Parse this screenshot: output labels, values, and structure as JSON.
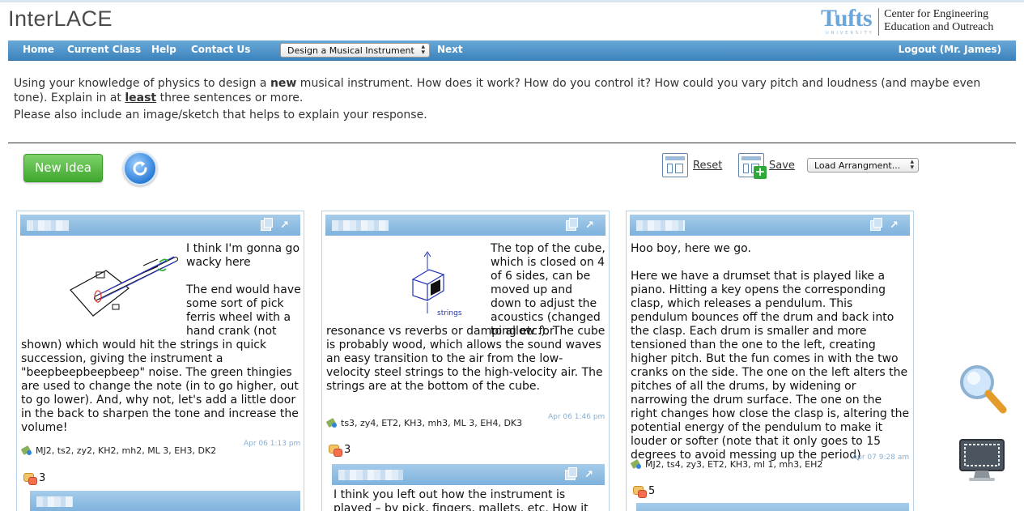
{
  "app": {
    "title": "InterLACE"
  },
  "logo": {
    "wordmark": "Tufts",
    "sub": "UNIVERSITY",
    "center_line1": "Center for Engineering",
    "center_line2": "Education and Outreach"
  },
  "nav": {
    "home": "Home",
    "current_class": "Current Class",
    "help": "Help",
    "contact": "Contact Us",
    "activity_select": "Design a Musical Instrument",
    "next": "Next",
    "logout": "Logout (Mr. James)"
  },
  "prompt": {
    "part1": "Using your knowledge of physics to design a ",
    "bold": "new",
    "part2": " musical instrument. How does it work? How do you control it?  How could you vary pitch and loudness (and maybe even tone). Explain in at ",
    "underline": "least",
    "part3": " three sentences or more.",
    "line2": "Please also include an image/sketch that helps to explain your response."
  },
  "toolbar": {
    "new_idea": "New Idea",
    "reset": "Reset",
    "save": "Save",
    "load_select": "Load Arrangment..."
  },
  "cards": [
    {
      "p1": "I think I'm gonna go wacky here",
      "p2": "The end would have some sort of pick ferris wheel with a hand crank (not shown) which would hit the strings in quick succession, giving the instrument a \"beepbeepbeepbeep\" noise. The green thingies are used to change the note (in to go higher, out to go lower). And, why not, let's add a little door in the back to sharpen the tone and increase the volume!",
      "timestamp": "Apr 06 1:13 pm",
      "tags": "MJ2, ts2, zy2, KH2, mh2, ML 3, EH3, DK2",
      "comments": "3"
    },
    {
      "p1": "The top of the cube, which is closed on 4 of 6 sides, can be moved up and down to adjust the acoustics (changed to allow for resonance vs reverbs or damping etc.). The cube is probably wood, which allows the sound waves an easy transition to the air from the low-velocity steel strings to the high-velocity air. The strings are at the bottom of the cube.",
      "sketch_label": "strings",
      "timestamp": "Apr 06 1:46 pm",
      "tags": "ts3, zy4, ET2, KH3, mh3, ML 3, EH4, DK3",
      "comments": "3",
      "reply": "I think you left out how the instrument is played – by pick, fingers, mallets, etc. How it would by"
    },
    {
      "p1": "Hoo boy, here we go.",
      "p2": "Here we have a drumset that is played like a piano. Hitting a key opens the corresponding clasp, which releases a pendulum. This pendulum bounces off the drum and back into the clasp. Each drum is smaller and more tensioned than the one to the left, creating higher pitch. But the fun comes in with the two cranks on the side. The one on the left alters the pitches of all the drums, by widening or narrowing the drum surface. The one on the right changes how close the clasp is, altering the potential energy of the pendulum to make it louder or softer (note that it only goes to 15 degrees to avoid messing up the period)",
      "timestamp": "Apr 07 9:28 am",
      "tags": "MJ2, ts4, zy3, ET2, KH3, ml 1, mh3, EH2",
      "comments": "5"
    }
  ]
}
